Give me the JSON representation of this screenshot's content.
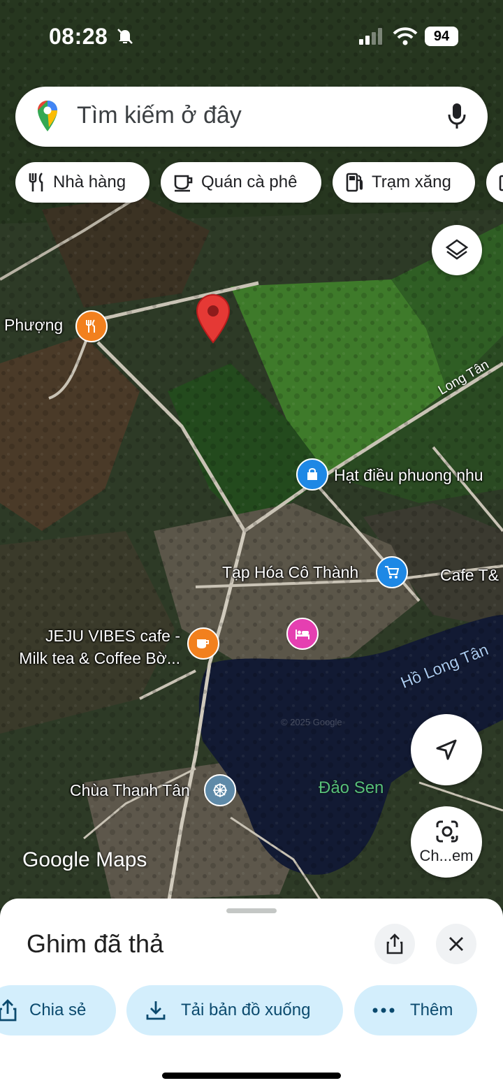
{
  "status": {
    "time": "08:28",
    "battery": "94"
  },
  "search": {
    "placeholder": "Tìm kiếm ở đây"
  },
  "chips": [
    {
      "label": "Nhà hàng",
      "icon": "restaurant-icon"
    },
    {
      "label": "Quán cà phê",
      "icon": "coffee-icon"
    },
    {
      "label": "Trạm xăng",
      "icon": "gas-station-icon"
    }
  ],
  "map": {
    "places": [
      {
        "name": "Phượng",
        "icon": "restaurant-icon"
      },
      {
        "name": "Hạt điều phuong nhu",
        "icon": "shopping-bag-icon"
      },
      {
        "name": "Tạp Hóa Cô Thành",
        "icon": "cart-icon"
      },
      {
        "name": "Cafe T&",
        "icon": ""
      },
      {
        "name": "JEJU VIBES cafe -",
        "name2": "Milk tea & Coffee Bờ...",
        "icon": "coffee-icon"
      },
      {
        "name": "",
        "icon": "hotel-icon"
      },
      {
        "name": "Chùa Thanh Tân",
        "icon": "dharma-wheel-icon"
      }
    ],
    "road_label": "Long Tân",
    "lake_label": "Hồ Long Tân",
    "island_label": "Đảo Sen",
    "watermark": "© 2025 Google",
    "brand": "Google Maps",
    "camera_label": "Ch...em"
  },
  "sheet": {
    "title": "Ghim đã thả",
    "actions": [
      {
        "label": "Chia sẻ"
      },
      {
        "label": "Tải bản đồ xuống"
      },
      {
        "label": "Thêm"
      }
    ]
  }
}
